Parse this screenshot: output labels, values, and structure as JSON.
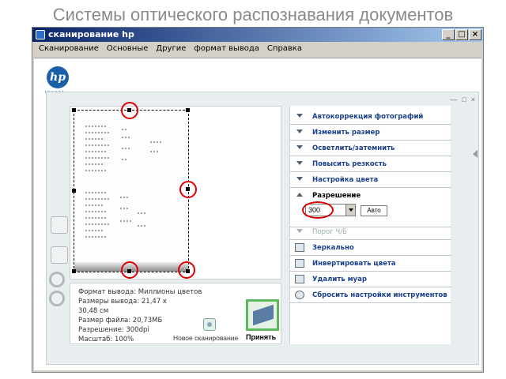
{
  "slide": {
    "title": "Системы оптического распознавания документов"
  },
  "window": {
    "title": "сканирование hp",
    "controls": {
      "minimize": "_",
      "maximize": "□",
      "close": "×"
    }
  },
  "menu": [
    "Сканирование",
    "Основные",
    "Другие",
    "формат вывода",
    "Справка"
  ],
  "logo": {
    "brand": "hp",
    "tagline": "invent"
  },
  "panel_controls": {
    "minimize": "—",
    "maximize": "□",
    "close": "×"
  },
  "tools": [
    {
      "label": "Автокоррекция фотографий",
      "icon": "chevron-down-icon",
      "muted": false
    },
    {
      "label": "Изменить размер",
      "icon": "chevron-down-icon",
      "muted": false
    },
    {
      "label": "Осветлить/затемнить",
      "icon": "chevron-down-icon",
      "muted": false
    },
    {
      "label": "Повысить резкость",
      "icon": "chevron-down-icon",
      "muted": false
    },
    {
      "label": "Настройка цвета",
      "icon": "chevron-down-icon",
      "muted": false
    },
    {
      "label": "Разрешение",
      "icon": "chevron-up-icon",
      "muted": false
    },
    {
      "label": "Порог Ч/Б",
      "icon": "chevron-down-icon",
      "muted": true
    },
    {
      "label": "Зеркально",
      "icon": "mirror-icon",
      "muted": false
    },
    {
      "label": "Инвертировать цвета",
      "icon": "invert-icon",
      "muted": false
    },
    {
      "label": "Удалить муар",
      "icon": "moire-icon",
      "muted": false
    },
    {
      "label": "Сбросить настройки инструментов",
      "icon": "reset-icon",
      "muted": false
    }
  ],
  "resolution": {
    "value": "300",
    "auto_label": "Авто"
  },
  "info": {
    "format": "Формат вывода: Миллионы цветов",
    "size_line1": "Размеры вывода: 21,47 x",
    "size_line2": "30,48 см",
    "file_size": "Размер файла: 20,73МБ",
    "resolution": "Разрешение:  300dpi",
    "scale": "Масштаб:  100%"
  },
  "actions": {
    "new_scan": "Новое сканирование",
    "accept": "Принять"
  },
  "colors": {
    "highlight": "#e00000",
    "title_bar": "#0a246a",
    "tool_text": "#1a3f8c"
  }
}
